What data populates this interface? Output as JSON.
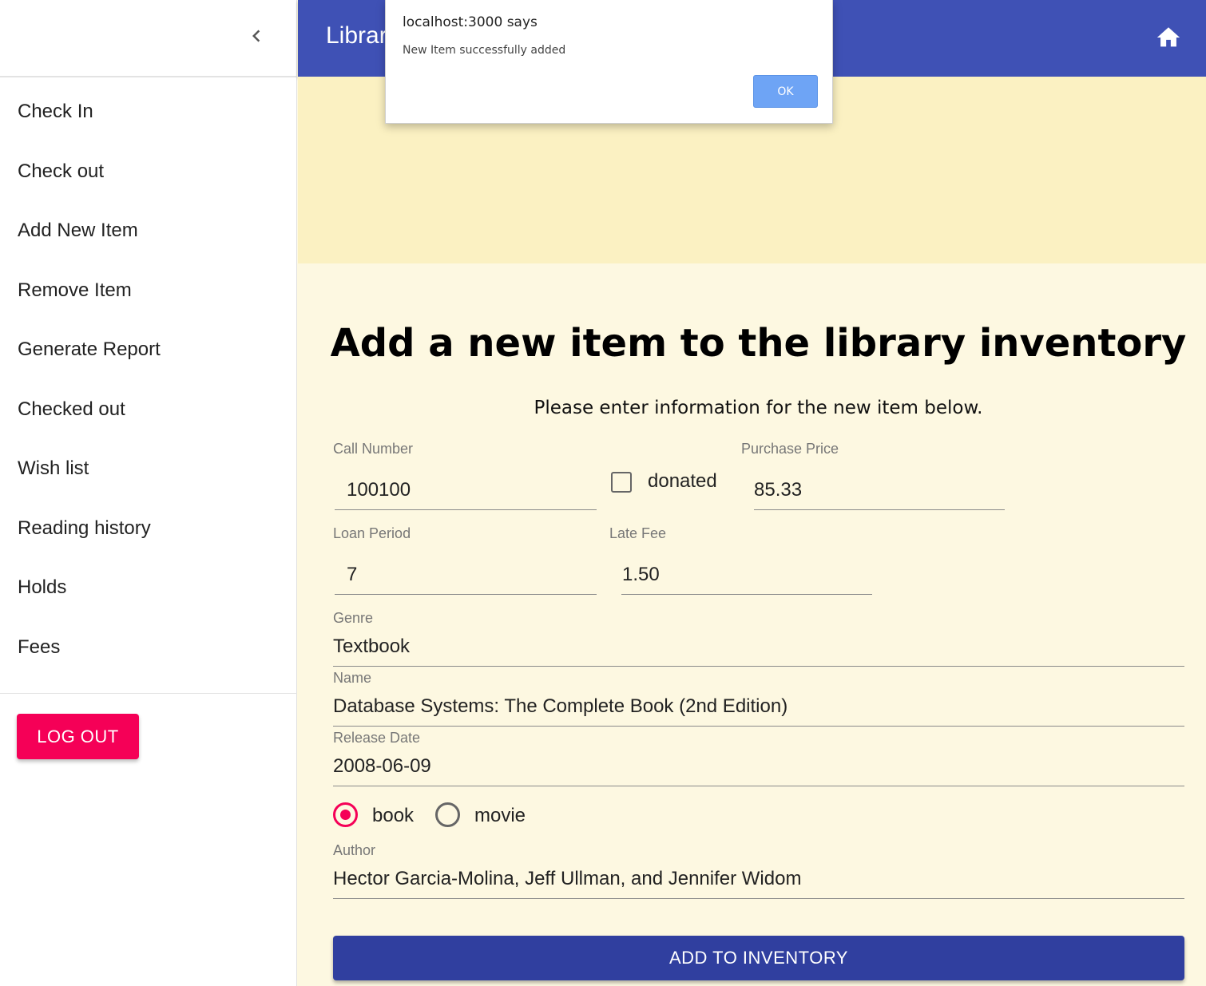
{
  "sidebar": {
    "items": [
      {
        "label": "Check In"
      },
      {
        "label": "Check out"
      },
      {
        "label": "Add New Item"
      },
      {
        "label": "Remove Item"
      },
      {
        "label": "Generate Report"
      },
      {
        "label": "Checked out"
      },
      {
        "label": "Wish list"
      },
      {
        "label": "Reading history"
      },
      {
        "label": "Holds"
      },
      {
        "label": "Fees"
      }
    ],
    "logout_label": "LOG OUT",
    "collapse_icon": "chevron-left-icon"
  },
  "appbar": {
    "title": "Library",
    "home_icon": "home-icon",
    "color": "#3f51b5"
  },
  "form": {
    "title": "Add a new item to the library inventory",
    "subtitle": "Please enter information for the new item below.",
    "call_number": {
      "label": "Call Number",
      "value": "100100"
    },
    "donated": {
      "label": "donated",
      "checked": false
    },
    "purchase_price": {
      "label": "Purchase Price",
      "value": "85.33"
    },
    "loan_period": {
      "label": "Loan Period",
      "value": "7"
    },
    "late_fee": {
      "label": "Late Fee",
      "value": "1.50"
    },
    "genre": {
      "label": "Genre",
      "value": "Textbook"
    },
    "name": {
      "label": "Name",
      "value": "Database Systems: The Complete Book (2nd Edition)"
    },
    "release_date": {
      "label": "Release Date",
      "value": "2008-06-09"
    },
    "type": {
      "options": [
        "book",
        "movie"
      ],
      "selected": "book"
    },
    "author": {
      "label": "Author",
      "value": "Hector Garcia-Molina, Jeff Ullman, and Jennifer Widom"
    },
    "submit_label": "ADD TO INVENTORY"
  },
  "alert": {
    "title": "localhost:3000 says",
    "message": "New Item successfully added",
    "ok_label": "OK"
  },
  "colors": {
    "accent": "#f50057",
    "primary": "#3f51b5",
    "button_primary": "#303f9f",
    "banner": "#fbf1c2",
    "background": "#fdf8e1"
  }
}
